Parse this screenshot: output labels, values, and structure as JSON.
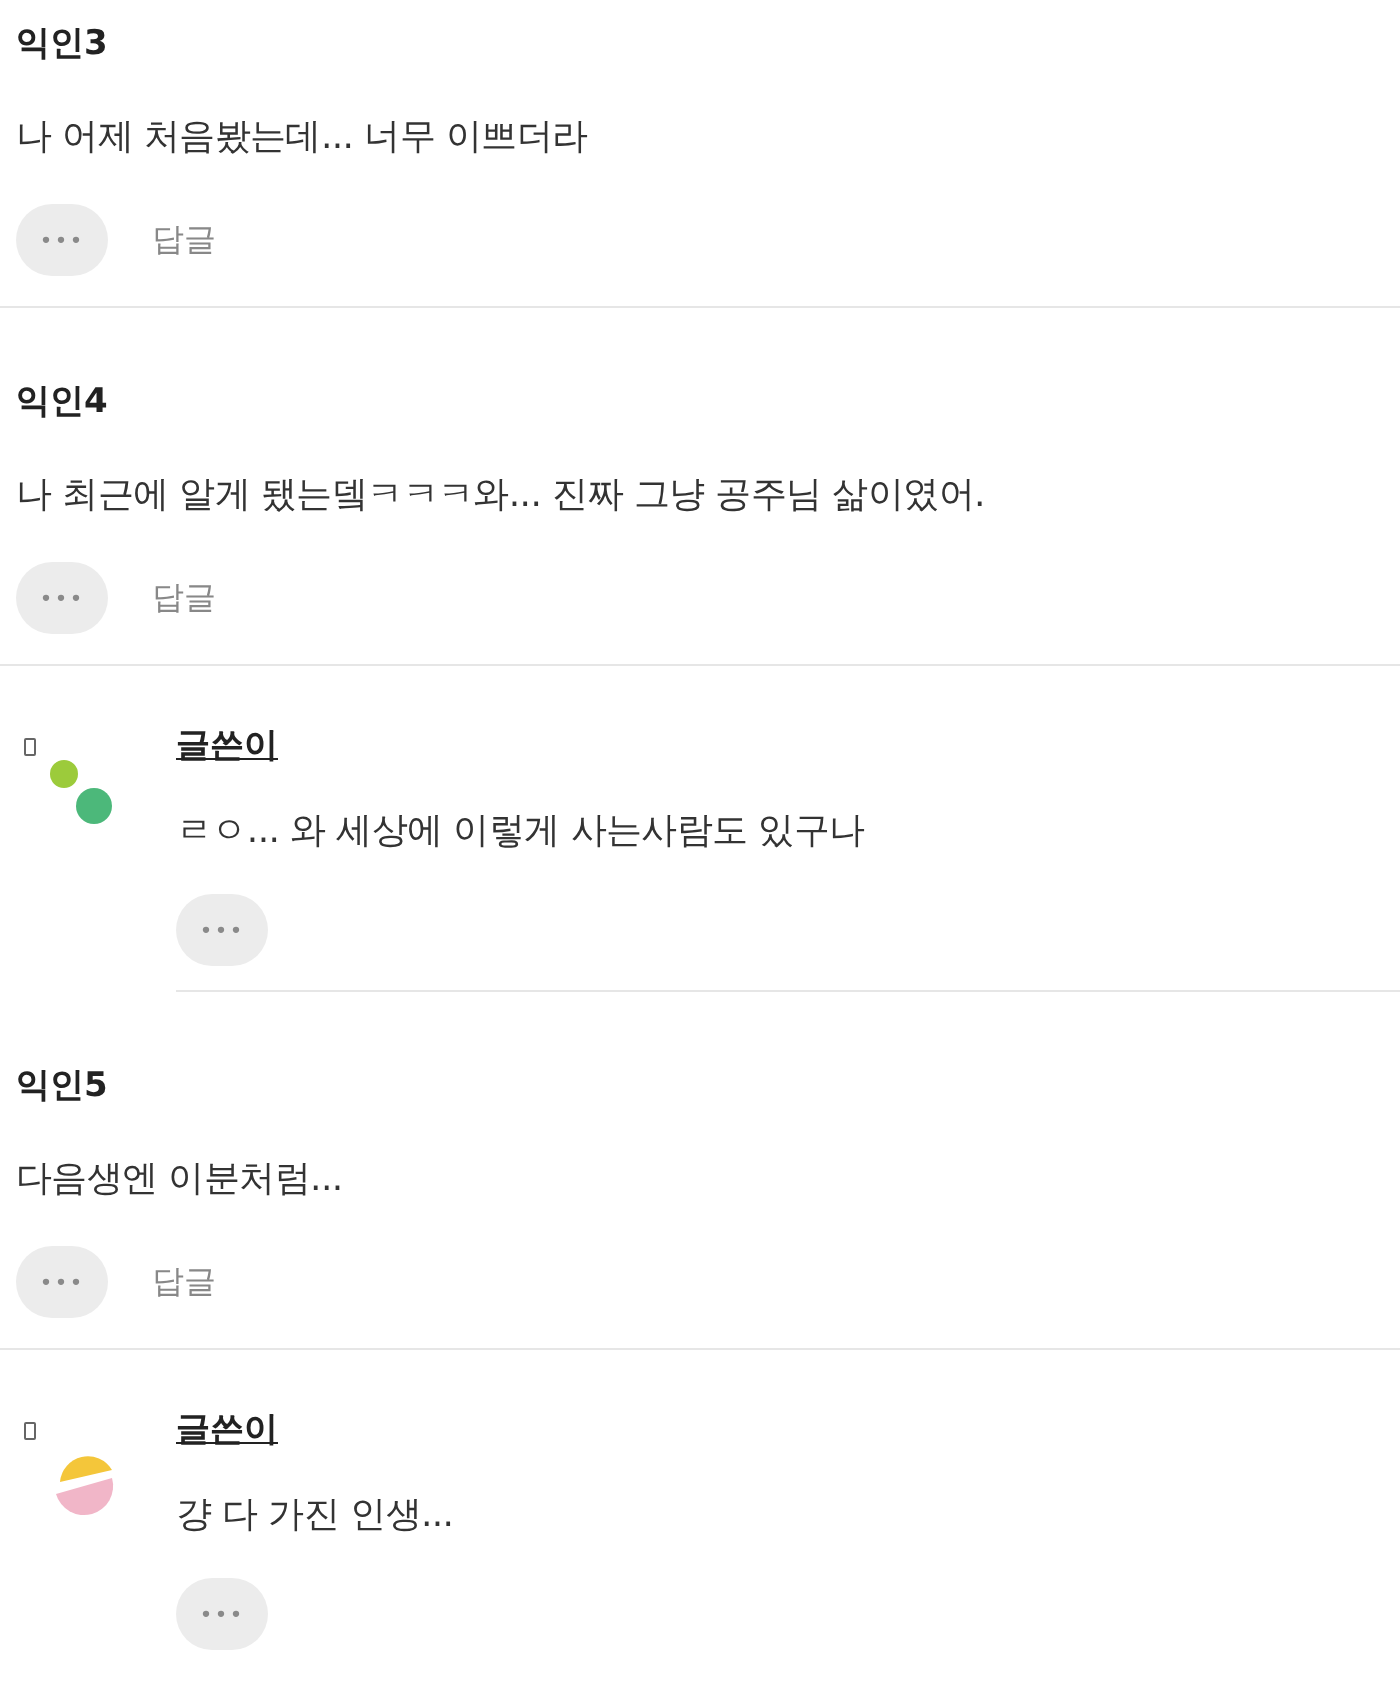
{
  "comments": [
    {
      "kind": "comment",
      "author": "익인3",
      "text": "나 어제 처음봤는데... 너무 이쁘더라",
      "more": "•••",
      "reply": "답글"
    },
    {
      "kind": "comment",
      "author": "익인4",
      "text": "나 최근에 알게 됐는뎈ㅋㅋㅋ와... 진짜 그냥 공주님 삶이였어.",
      "more": "•••",
      "reply": "답글"
    },
    {
      "kind": "reply",
      "author": "글쓴이",
      "text": "ㄹㅇ... 와 세상에 이렇게 사는사람도 있구나",
      "more": "•••",
      "avatar": {
        "kind": "dots"
      }
    },
    {
      "kind": "comment",
      "author": "익인5",
      "text": "다음생엔 이분처럼...",
      "more": "•••",
      "reply": "답글"
    },
    {
      "kind": "reply",
      "author": "글쓴이",
      "text": "걍 다 가진 인생...",
      "more": "•••",
      "avatar": {
        "kind": "halves"
      }
    }
  ]
}
